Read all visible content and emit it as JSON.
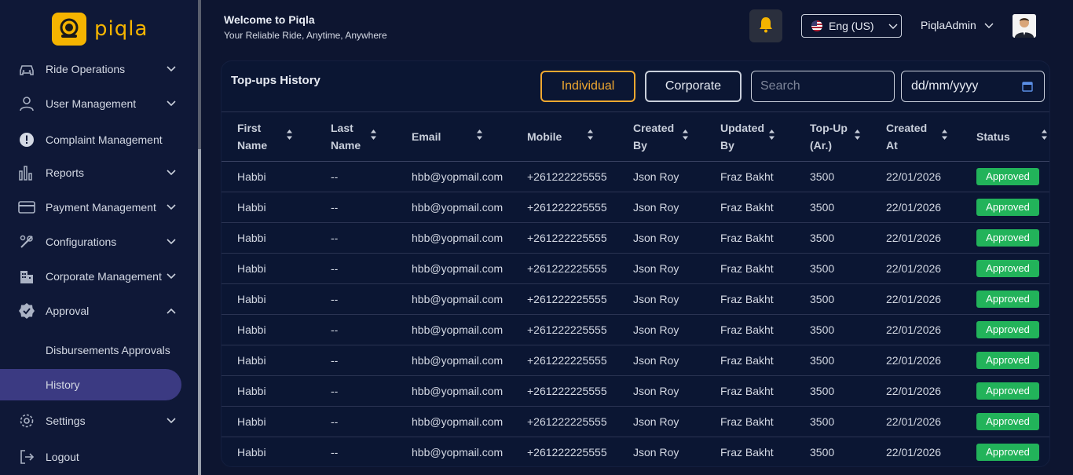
{
  "brand": {
    "name": "piqla",
    "color": "#f5b400"
  },
  "sidebar": {
    "items": [
      {
        "label": "Ride Operations",
        "icon": "car-icon",
        "expanded": false
      },
      {
        "label": "User Management",
        "icon": "user-icon",
        "expanded": false
      },
      {
        "label": "Complaint Management",
        "icon": "alert-circle-icon"
      },
      {
        "label": "Reports",
        "icon": "bar-chart-icon",
        "expanded": false
      },
      {
        "label": "Payment Management",
        "icon": "credit-card-icon",
        "expanded": false
      },
      {
        "label": "Configurations",
        "icon": "tools-icon",
        "expanded": false
      },
      {
        "label": "Corporate Management",
        "icon": "building-icon",
        "expanded": false
      },
      {
        "label": "Approval",
        "icon": "badge-check-icon",
        "expanded": true
      },
      {
        "label": "Settings",
        "icon": "gear-icon",
        "expanded": false
      },
      {
        "label": "Logout",
        "icon": "logout-icon"
      }
    ],
    "approval_sub": [
      {
        "label": "Disbursements Approvals",
        "active": false
      },
      {
        "label": "History",
        "active": true
      }
    ]
  },
  "header": {
    "welcome_title": "Welcome to Piqla",
    "welcome_sub": "Your Reliable Ride, Anytime, Anywhere",
    "language": "Eng (US)",
    "user": "PiqlaAdmin"
  },
  "panel": {
    "title": "Top-ups History",
    "individual_label": "Individual",
    "corporate_label": "Corporate",
    "search_placeholder": "Search",
    "date_placeholder": "dd/mm/yyyy"
  },
  "table": {
    "columns": [
      "First Name",
      "Last Name",
      "Email",
      "Mobile",
      "Created By",
      "Updated By",
      "Top-Up (Ar.)",
      "Created At",
      "Status"
    ],
    "rows": [
      [
        "Habbi",
        "--",
        "hbb@yopmail.com",
        "+261222225555",
        "Json Roy",
        "Fraz Bakht",
        "3500",
        "22/01/2026",
        "Approved"
      ],
      [
        "Habbi",
        "--",
        "hbb@yopmail.com",
        "+261222225555",
        "Json Roy",
        "Fraz Bakht",
        "3500",
        "22/01/2026",
        "Approved"
      ],
      [
        "Habbi",
        "--",
        "hbb@yopmail.com",
        "+261222225555",
        "Json Roy",
        "Fraz Bakht",
        "3500",
        "22/01/2026",
        "Approved"
      ],
      [
        "Habbi",
        "--",
        "hbb@yopmail.com",
        "+261222225555",
        "Json Roy",
        "Fraz Bakht",
        "3500",
        "22/01/2026",
        "Approved"
      ],
      [
        "Habbi",
        "--",
        "hbb@yopmail.com",
        "+261222225555",
        "Json Roy",
        "Fraz Bakht",
        "3500",
        "22/01/2026",
        "Approved"
      ],
      [
        "Habbi",
        "--",
        "hbb@yopmail.com",
        "+261222225555",
        "Json Roy",
        "Fraz Bakht",
        "3500",
        "22/01/2026",
        "Approved"
      ],
      [
        "Habbi",
        "--",
        "hbb@yopmail.com",
        "+261222225555",
        "Json Roy",
        "Fraz Bakht",
        "3500",
        "22/01/2026",
        "Approved"
      ],
      [
        "Habbi",
        "--",
        "hbb@yopmail.com",
        "+261222225555",
        "Json Roy",
        "Fraz Bakht",
        "3500",
        "22/01/2026",
        "Approved"
      ],
      [
        "Habbi",
        "--",
        "hbb@yopmail.com",
        "+261222225555",
        "Json Roy",
        "Fraz Bakht",
        "3500",
        "22/01/2026",
        "Approved"
      ],
      [
        "Habbi",
        "--",
        "hbb@yopmail.com",
        "+261222225555",
        "Json Roy",
        "Fraz Bakht",
        "3500",
        "22/01/2026",
        "Approved"
      ]
    ]
  },
  "colors": {
    "accent": "#f0a830",
    "approved": "#22b35a",
    "active_nav": "#3b3a82"
  }
}
